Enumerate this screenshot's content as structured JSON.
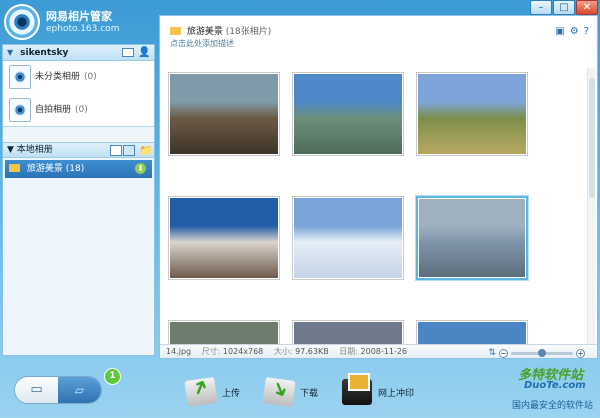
{
  "app": {
    "name": "网易相片管家",
    "url": "ephoto.163.com"
  },
  "sidebar": {
    "username": "sikentsky",
    "albums": [
      {
        "label": "未分类相册",
        "count": "(0)"
      },
      {
        "label": "自拍相册",
        "count": "(0)"
      }
    ],
    "local_header": "本地相册",
    "local_albums": [
      {
        "label": "旅游美景 (18)"
      }
    ]
  },
  "main": {
    "album_title": "旅游美景",
    "album_count": "(18张相片)",
    "description_placeholder": "点击此处添加描述",
    "photos": [
      {
        "name": "waterwheel",
        "colors": [
          "#7f9aa8",
          "#6c5a44",
          "#3e3428"
        ]
      },
      {
        "name": "coast-arch",
        "colors": [
          "#4f88c8",
          "#6d8f7c",
          "#4f6b5a"
        ]
      },
      {
        "name": "grassland",
        "colors": [
          "#7da4d8",
          "#7c8e4a",
          "#b8a863"
        ]
      },
      {
        "name": "potala-palace",
        "colors": [
          "#235ea8",
          "#d9d4cd",
          "#6f5a4b"
        ]
      },
      {
        "name": "snow-village",
        "colors": [
          "#7aa5d8",
          "#e6eef7",
          "#c4d3e6"
        ]
      },
      {
        "name": "lake-shore",
        "colors": [
          "#9fb0be",
          "#7f95a8",
          "#5d6f7e"
        ]
      },
      {
        "name": "row3-a",
        "colors": [
          "#6d7c6c",
          "#9aa28a",
          "#ffffff"
        ]
      },
      {
        "name": "row3-b",
        "colors": [
          "#6f7b8d",
          "#8b96a4",
          "#ffffff"
        ]
      },
      {
        "name": "row3-c",
        "colors": [
          "#4a86c4",
          "#a9c8e4",
          "#ffffff"
        ]
      }
    ]
  },
  "status": {
    "filename": "14.jpg",
    "size_label": "尺寸:",
    "size_value": "1024x768",
    "filesize_label": "大小:",
    "filesize_value": "97.63KB",
    "date_label": "日期:",
    "date_value": "2008-11-26",
    "zoom_level": 0.5
  },
  "toolbar": {
    "badge": "1",
    "upload_label": "上传",
    "download_label": "下载",
    "print_label": "网上冲印"
  },
  "watermark": {
    "line1": "多特软件站",
    "line2": "DuoTe.com",
    "line3": "国内最安全的软件站"
  },
  "colors": {
    "accent": "#3c9bd4",
    "selected_row": "#2b73b8",
    "selection_border": "#5bb6e8"
  }
}
